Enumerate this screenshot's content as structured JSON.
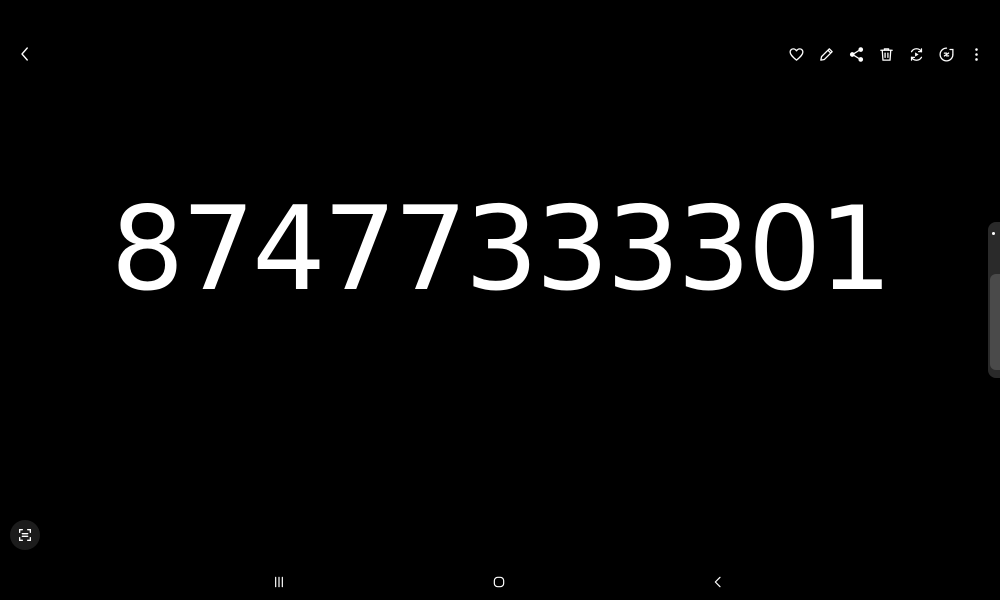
{
  "image": {
    "text": "87477333301",
    "text_color": "#ffffff",
    "background": "#000000"
  },
  "toolbar": {
    "back_icon": "chevron-left-icon",
    "actions": [
      {
        "name": "favorite",
        "icon": "heart-icon"
      },
      {
        "name": "edit",
        "icon": "pencil-icon"
      },
      {
        "name": "share",
        "icon": "share-icon"
      },
      {
        "name": "delete",
        "icon": "trash-icon"
      },
      {
        "name": "remaster",
        "icon": "remaster-icon"
      },
      {
        "name": "bixby-vision",
        "icon": "bixby-vision-icon"
      },
      {
        "name": "more-options",
        "icon": "more-vertical-icon"
      }
    ]
  },
  "overlay": {
    "scan_text_icon": "scan-text-icon",
    "edge_panel_handle": "edge-panel-handle"
  },
  "navbar": {
    "recents_icon": "recents-icon",
    "home_icon": "home-icon",
    "back_icon": "nav-back-icon"
  },
  "colors": {
    "icon": "#ffffff",
    "handle": "#2a2a2a",
    "handle_segment": "#4a4a4a"
  }
}
